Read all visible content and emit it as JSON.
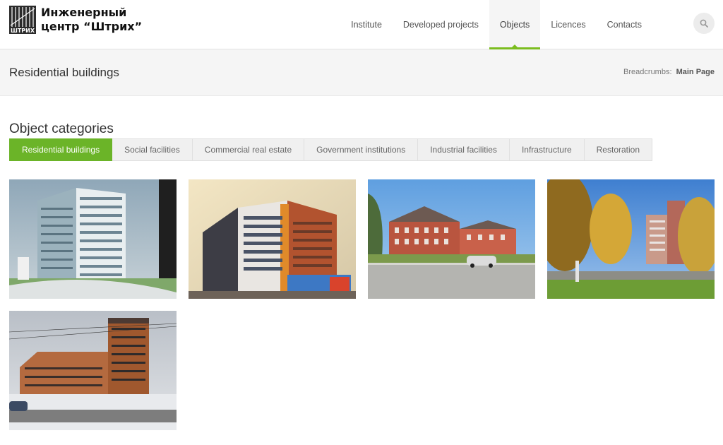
{
  "header": {
    "logo_line1": "Инженерный",
    "logo_line2": "центр “Штрих”",
    "logo_mark_text": "ШТРИХ",
    "nav": [
      {
        "label": "Institute",
        "active": false
      },
      {
        "label": "Developed projects",
        "active": false
      },
      {
        "label": "Objects",
        "active": true
      },
      {
        "label": "Licences",
        "active": false
      },
      {
        "label": "Contacts",
        "active": false
      }
    ],
    "search_icon": "search-icon"
  },
  "title_bar": {
    "page_title": "Residential buildings",
    "breadcrumbs_label": "Breadcrumbs:",
    "breadcrumbs_link": "Main Page"
  },
  "categories": {
    "title": "Object categories",
    "tabs": [
      {
        "label": "Residential buildings",
        "active": true
      },
      {
        "label": "Social facilities",
        "active": false
      },
      {
        "label": "Commercial real estate",
        "active": false
      },
      {
        "label": "Government institutions",
        "active": false
      },
      {
        "label": "Industrial facilities",
        "active": false
      },
      {
        "label": "Infrastructure",
        "active": false
      },
      {
        "label": "Restoration",
        "active": false
      }
    ]
  },
  "colors": {
    "accent": "#6bb428",
    "nav_underline": "#7bbd1f"
  },
  "gallery": {
    "count": 5
  }
}
